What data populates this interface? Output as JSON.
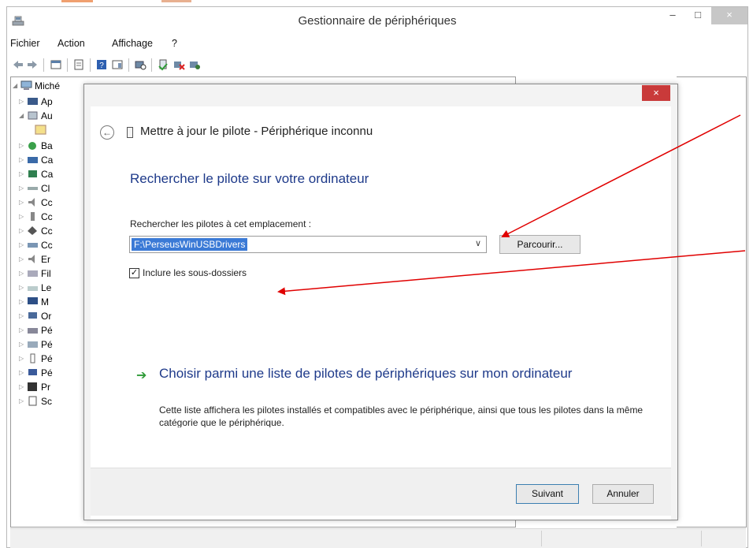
{
  "window": {
    "title": "Gestionnaire de périphériques",
    "controls": {
      "minimize": "–",
      "maximize": "□",
      "close": "×"
    }
  },
  "menu": [
    "Fichier",
    "Action",
    "Affichage",
    "?"
  ],
  "toolbar": {
    "icons": [
      "back-arrow-icon",
      "forward-arrow-icon",
      "properties-icon",
      "view-icon",
      "help-icon",
      "list-icon",
      "scan-hardware-icon",
      "update-driver-icon",
      "uninstall-icon",
      "disable-icon"
    ]
  },
  "tree": {
    "root": "Miché",
    "items": [
      "Ap",
      "Au",
      "",
      "Ba",
      "Ca",
      "Ca",
      "Cl",
      "Cc",
      "Cc",
      "Cc",
      "Cc",
      "Er",
      "Fil",
      "Le",
      "M",
      "Or",
      "Pé",
      "Pé",
      "Pé",
      "Pé",
      "Pr",
      "Sc"
    ]
  },
  "dialog": {
    "close": "×",
    "title": "Mettre à jour le pilote - Périphérique inconnu",
    "heading": "Rechercher le pilote sur votre ordinateur",
    "location_label": "Rechercher les pilotes à cet emplacement :",
    "location_value": "F:\\PerseusWinUSBDrivers",
    "browse_label": "Parcourir...",
    "include_subfolders_label": "Inclure les sous-dossiers",
    "include_subfolders_checked": true,
    "choose_link": "Choisir parmi une liste de pilotes de périphériques sur mon ordinateur",
    "choose_desc": "Cette liste affichera les pilotes installés et compatibles avec le périphérique, ainsi que tous les pilotes dans la même catégorie que le périphérique.",
    "next_label": "Suivant",
    "cancel_label": "Annuler"
  },
  "colors": {
    "accent_blue": "#1e3a8a",
    "selection": "#3b7ad6",
    "close_red": "#c93a3a",
    "link_arrow_green": "#2e9a37",
    "annotation_red": "#e00000"
  }
}
